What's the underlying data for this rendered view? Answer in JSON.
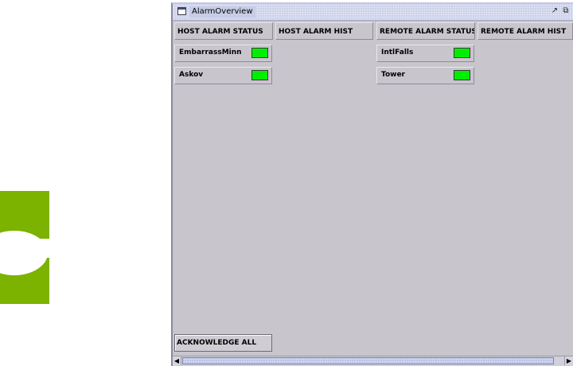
{
  "window": {
    "title": "AlarmOverview",
    "minimize_icon": "restore-down-icon",
    "maximize_icon": "maximize-icon"
  },
  "columns": {
    "host_status": "HOST ALARM STATUS",
    "host_hist": "HOST ALARM HIST",
    "remote_status": "REMOTE ALARM STATUS",
    "remote_hist": "REMOTE ALARM HIST"
  },
  "host_sites": [
    {
      "name": "EmbarrassMinn",
      "status": "ok"
    },
    {
      "name": "Askov",
      "status": "ok"
    }
  ],
  "remote_sites": [
    {
      "name": "IntlFalls",
      "status": "ok"
    },
    {
      "name": "Tower",
      "status": "ok"
    }
  ],
  "status_colors": {
    "ok": "#00ee00"
  },
  "actions": {
    "acknowledge_all": "ACKNOWLEDGE ALL"
  }
}
